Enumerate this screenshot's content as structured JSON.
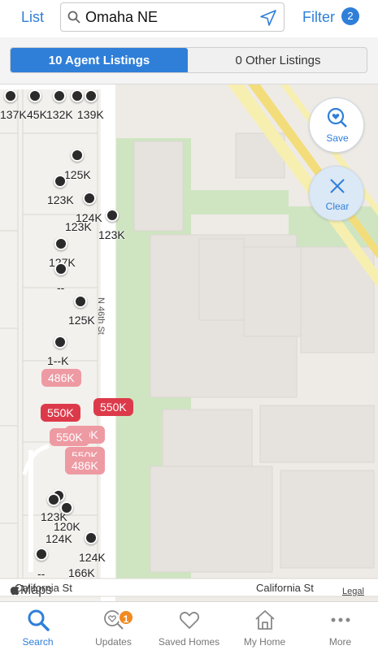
{
  "header": {
    "list_label": "List",
    "search_value": "Omaha NE",
    "filter_label": "Filter",
    "filter_count": "2"
  },
  "segments": {
    "agent": "10 Agent Listings",
    "other": "0 Other Listings"
  },
  "map": {
    "buttons": {
      "save": "Save",
      "clear": "Clear"
    },
    "streets": {
      "n46": "N 46th St",
      "california_left": "California St",
      "california_right": "California St"
    },
    "attribution": {
      "maps": "Maps",
      "legal": "Legal"
    },
    "pin_labels": [
      "137K",
      "45K",
      "132K",
      "139K",
      "125K",
      "123K",
      "124K",
      "123K",
      "123K",
      "127K",
      "--",
      "125K",
      "1--K",
      "123K",
      "120K",
      "124K",
      "124K",
      "--",
      "166K"
    ],
    "price_bubbles": [
      "486K",
      "550K",
      "550K",
      "550K",
      "550K",
      "550K",
      "486K"
    ]
  },
  "tabs": [
    {
      "label": "Search",
      "icon": "search-icon"
    },
    {
      "label": "Updates",
      "icon": "updates-icon",
      "badge": "1"
    },
    {
      "label": "Saved Homes",
      "icon": "heart-icon"
    },
    {
      "label": "My Home",
      "icon": "house-icon"
    },
    {
      "label": "More",
      "icon": "more-icon"
    }
  ],
  "colors": {
    "accent": "#2f7fd9",
    "pin_red": "#dc3a4a",
    "pin_pink": "#ee9aa3",
    "badge": "#f08a22",
    "park": "#cfe5c2"
  }
}
